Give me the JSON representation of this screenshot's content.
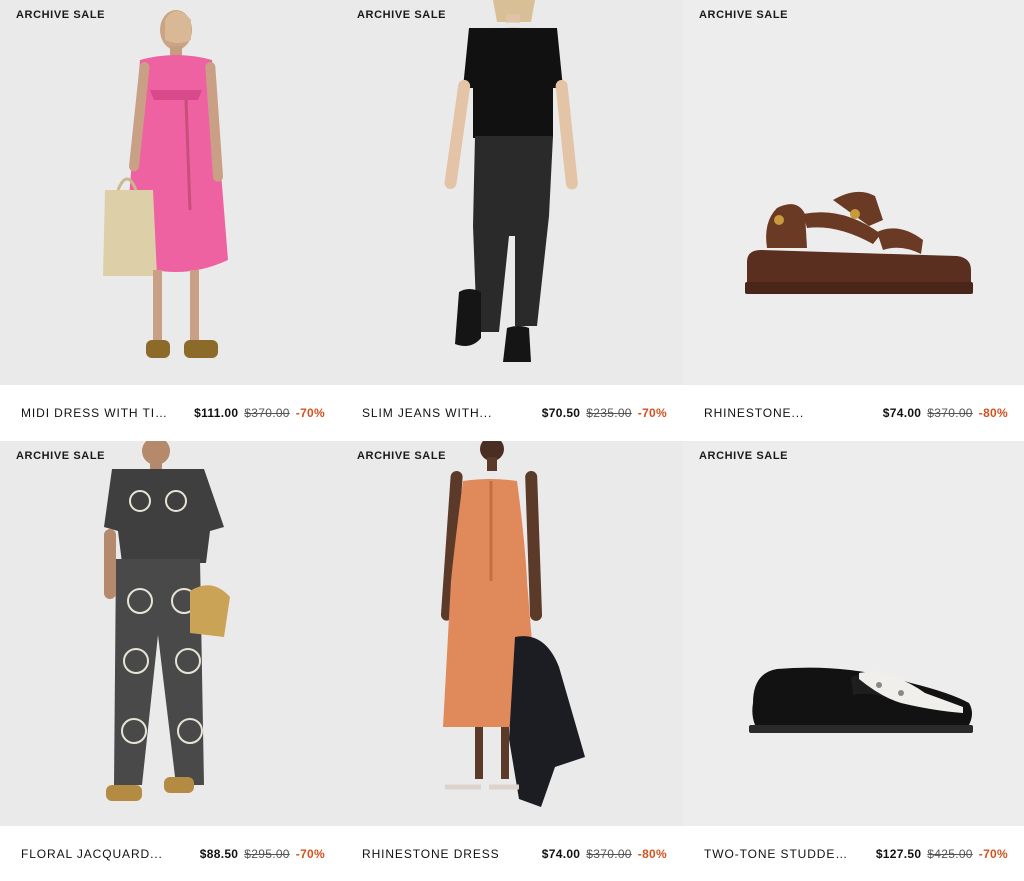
{
  "products": [
    {
      "tag": "ARCHIVE SALE",
      "name": "MIDI DRESS WITH TIE...",
      "price": "$111.00",
      "old_price": "$370.00",
      "discount": "-70%",
      "image_alt": "Model in pink patterned midi dress holding a straw tote"
    },
    {
      "tag": "ARCHIVE SALE",
      "name": "SLIM JEANS WITH...",
      "price": "$70.50",
      "old_price": "$235.00",
      "discount": "-70%",
      "image_alt": "Model in black t-shirt, black slim jeans and boots"
    },
    {
      "tag": "ARCHIVE SALE",
      "name": "RHINESTONE...",
      "price": "$74.00",
      "old_price": "$370.00",
      "discount": "-80%",
      "image_alt": "Brown studded strap sandal"
    },
    {
      "tag": "ARCHIVE SALE",
      "name": "FLORAL JACQUARD...",
      "price": "$88.50",
      "old_price": "$295.00",
      "discount": "-70%",
      "image_alt": "Model in black and white floral jacquard shirt and pants"
    },
    {
      "tag": "ARCHIVE SALE",
      "name": "RHINESTONE DRESS",
      "price": "$74.00",
      "old_price": "$370.00",
      "discount": "-80%",
      "image_alt": "Model in orange satin slip dress holding a leather jacket"
    },
    {
      "tag": "ARCHIVE SALE",
      "name": "TWO-TONE STUDDED...",
      "price": "$127.50",
      "old_price": "$425.00",
      "discount": "-70%",
      "image_alt": "Black two-tone studded loafer"
    }
  ],
  "colors": {
    "discount": "#d2521f",
    "image_background": "#ebeaea"
  }
}
